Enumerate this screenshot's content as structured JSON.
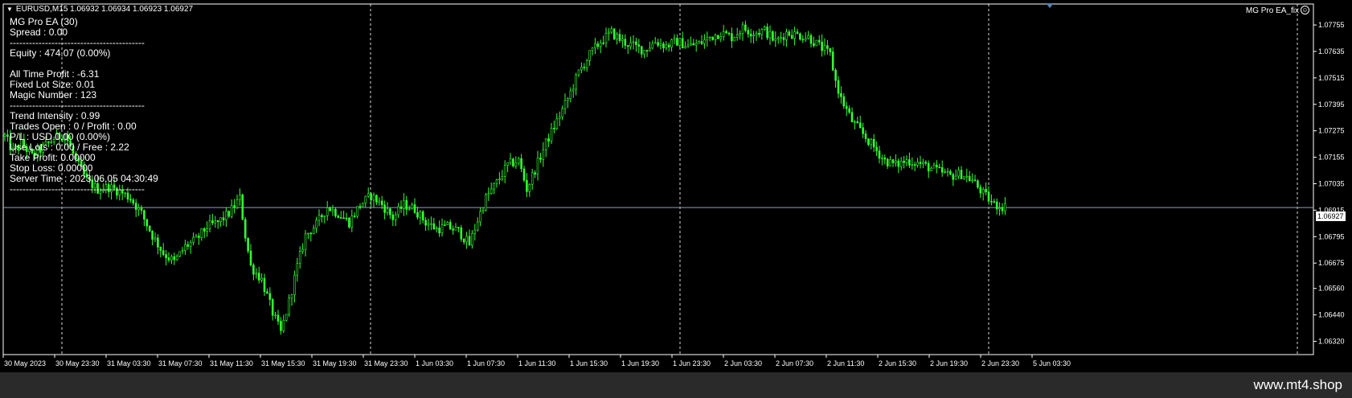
{
  "symbol_header": "EURUSD,M15  1.06932 1.06934 1.06923 1.06927",
  "ea_name": "MG Pro EA_fix",
  "info_panel": {
    "lines": [
      "MG Pro EA (30)",
      "Spread : 0.00",
      "------------------------------------------",
      "Equity : 474.07 (0.00%)",
      "",
      "All Time Profit : -6.31",
      "Fixed Lot Size: 0.01",
      "Magic Number : 123",
      "------------------------------------------",
      "Trend Intensity : 0.99",
      "Trades Open : 0 / Profit : 0.00",
      "P/L : USD 0.00 (0.00%)",
      "Use Lots : 0.00 / Free : 2.22",
      "Take Profit: 0.00000",
      "Stop Loss: 0.00000",
      "Server Time : 2023.06.05 04:30:49",
      "------------------------------------------"
    ]
  },
  "current_price_label": "1.06927",
  "watermark": "www.mt4.shop",
  "colors": {
    "background": "#000000",
    "candles": "#33ff33",
    "grid": "#ffffff",
    "price_line": "#8aa0b8"
  },
  "chart_data": {
    "type": "candlestick",
    "title": "",
    "price_axis_ticks": [
      "1.07755",
      "1.07635",
      "1.07515",
      "1.07395",
      "1.07275",
      "1.07155",
      "1.07035",
      "1.06915",
      "1.06795",
      "1.06675",
      "1.06560",
      "1.06440",
      "1.06320"
    ],
    "time_axis_ticks": [
      "30 May 2023",
      "30 May 23:30",
      "31 May 03:30",
      "31 May 07:30",
      "31 May 11:30",
      "31 May 15:30",
      "31 May 19:30",
      "31 May 23:30",
      "1 Jun 03:30",
      "1 Jun 07:30",
      "1 Jun 11:30",
      "1 Jun 15:30",
      "1 Jun 19:30",
      "1 Jun 23:30",
      "2 Jun 03:30",
      "2 Jun 07:30",
      "2 Jun 11:30",
      "2 Jun 15:30",
      "2 Jun 19:30",
      "2 Jun 23:30",
      "5 Jun 03:30"
    ],
    "current_price": 1.06927,
    "ylim": [
      1.0626,
      1.0785
    ],
    "grid": "period separators (dashed vertical)",
    "close_path": [
      [
        0,
        1.0725
      ],
      [
        3,
        1.0718
      ],
      [
        6,
        1.0722
      ],
      [
        10,
        1.0716
      ],
      [
        14,
        1.072
      ],
      [
        18,
        1.0724
      ],
      [
        22,
        1.0726
      ],
      [
        26,
        1.0714
      ],
      [
        30,
        1.0705
      ],
      [
        34,
        1.0701
      ],
      [
        38,
        1.0702
      ],
      [
        42,
        1.07
      ],
      [
        46,
        1.0697
      ],
      [
        50,
        1.069
      ],
      [
        54,
        1.068
      ],
      [
        58,
        1.0672
      ],
      [
        62,
        1.0668
      ],
      [
        66,
        1.0675
      ],
      [
        70,
        1.0678
      ],
      [
        74,
        1.0684
      ],
      [
        78,
        1.0686
      ],
      [
        82,
        1.069
      ],
      [
        86,
        1.0697
      ],
      [
        88,
        1.068
      ],
      [
        90,
        1.0666
      ],
      [
        94,
        1.066
      ],
      [
        98,
        1.0645
      ],
      [
        101,
        1.0636
      ],
      [
        104,
        1.065
      ],
      [
        107,
        1.0666
      ],
      [
        110,
        1.068
      ],
      [
        114,
        1.0685
      ],
      [
        118,
        1.0693
      ],
      [
        122,
        1.069
      ],
      [
        126,
        1.0686
      ],
      [
        130,
        1.0694
      ],
      [
        134,
        1.0698
      ],
      [
        138,
        1.0694
      ],
      [
        142,
        1.0688
      ],
      [
        146,
        1.0694
      ],
      [
        150,
        1.0692
      ],
      [
        154,
        1.0686
      ],
      [
        158,
        1.0683
      ],
      [
        162,
        1.0684
      ],
      [
        166,
        1.0682
      ],
      [
        170,
        1.0676
      ],
      [
        173,
        1.0687
      ],
      [
        176,
        1.0697
      ],
      [
        180,
        1.0704
      ],
      [
        184,
        1.0712
      ],
      [
        188,
        1.0714
      ],
      [
        191,
        1.0701
      ],
      [
        194,
        1.071
      ],
      [
        198,
        1.0722
      ],
      [
        202,
        1.0732
      ],
      [
        206,
        1.0742
      ],
      [
        210,
        1.0754
      ],
      [
        214,
        1.0762
      ],
      [
        218,
        1.0768
      ],
      [
        222,
        1.0772
      ],
      [
        226,
        1.0768
      ],
      [
        230,
        1.0766
      ],
      [
        234,
        1.0764
      ],
      [
        238,
        1.0768
      ],
      [
        242,
        1.0766
      ],
      [
        246,
        1.0768
      ],
      [
        250,
        1.0766
      ],
      [
        254,
        1.0767
      ],
      [
        258,
        1.077
      ],
      [
        262,
        1.0772
      ],
      [
        266,
        1.077
      ],
      [
        270,
        1.0774
      ],
      [
        274,
        1.0772
      ],
      [
        278,
        1.0773
      ],
      [
        282,
        1.0768
      ],
      [
        286,
        1.0772
      ],
      [
        290,
        1.0771
      ],
      [
        294,
        1.077
      ],
      [
        298,
        1.0766
      ],
      [
        302,
        1.0762
      ],
      [
        304,
        1.075
      ],
      [
        306,
        1.0742
      ],
      [
        310,
        1.0732
      ],
      [
        314,
        1.0726
      ],
      [
        318,
        1.072
      ],
      [
        322,
        1.0714
      ],
      [
        326,
        1.0712
      ],
      [
        330,
        1.0714
      ],
      [
        334,
        1.0713
      ],
      [
        338,
        1.0711
      ],
      [
        342,
        1.0709
      ],
      [
        346,
        1.0707
      ],
      [
        350,
        1.0708
      ],
      [
        354,
        1.0705
      ],
      [
        358,
        1.0699
      ],
      [
        362,
        1.0694
      ],
      [
        366,
        1.0693
      ]
    ]
  }
}
